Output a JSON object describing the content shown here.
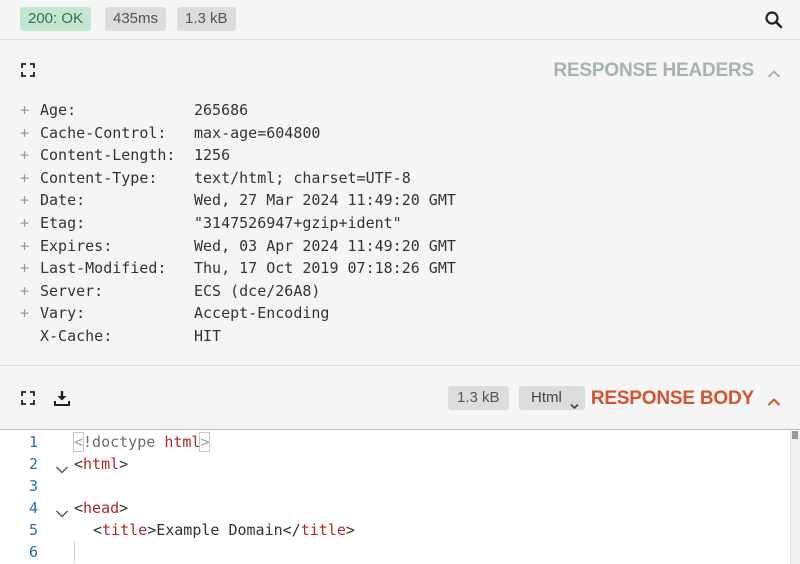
{
  "status_bar": {
    "status": "200: OK",
    "time": "435ms",
    "size": "1.3 kB",
    "search_icon": "search-icon",
    "colors": {
      "status_bg": "#c3e6d3",
      "status_text": "#3c6a52"
    }
  },
  "headers": {
    "title": "RESPONSE HEADERS",
    "items": [
      {
        "expand": "+",
        "name": "Age:",
        "value": "265686"
      },
      {
        "expand": "+",
        "name": "Cache-Control:",
        "value": "max-age=604800"
      },
      {
        "expand": "+",
        "name": "Content-Length:",
        "value": "1256"
      },
      {
        "expand": "+",
        "name": "Content-Type:",
        "value": "text/html; charset=UTF-8"
      },
      {
        "expand": "+",
        "name": "Date:",
        "value": "Wed, 27 Mar 2024 11:49:20 GMT"
      },
      {
        "expand": "+",
        "name": "Etag:",
        "value": "\"3147526947+gzip+ident\""
      },
      {
        "expand": "+",
        "name": "Expires:",
        "value": "Wed, 03 Apr 2024 11:49:20 GMT"
      },
      {
        "expand": "+",
        "name": "Last-Modified:",
        "value": "Thu, 17 Oct 2019 07:18:26 GMT"
      },
      {
        "expand": "+",
        "name": "Server:",
        "value": "ECS (dce/26A8)"
      },
      {
        "expand": "+",
        "name": "Vary:",
        "value": "Accept-Encoding"
      },
      {
        "expand": "",
        "name": "X-Cache:",
        "value": "HIT"
      }
    ]
  },
  "body": {
    "title": "RESPONSE BODY",
    "size": "1.3 kB",
    "format": "Html",
    "title_color": "#d4532e"
  },
  "editor": {
    "lines": [
      {
        "num": "1",
        "open": "<",
        "keyword": "!doctype",
        "tag": "html",
        "close": ">"
      },
      {
        "num": "2",
        "open": "<",
        "tag": "html",
        "close": ">"
      },
      {
        "num": "3"
      },
      {
        "num": "4",
        "open": "<",
        "tag": "head",
        "close": ">"
      },
      {
        "num": "5",
        "open": "<",
        "tag": "title",
        "close": ">",
        "text": "Example Domain",
        "end_open": "</",
        "end_tag": "title",
        "end_close": ">"
      },
      {
        "num": "6"
      }
    ]
  }
}
